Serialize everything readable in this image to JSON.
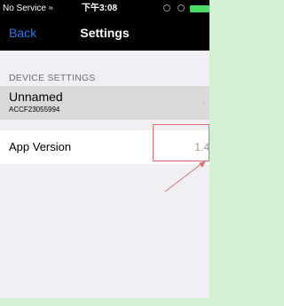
{
  "status_bar": {
    "carrier": "No Service",
    "wifi_icon": "wifi-icon",
    "time": "下午3:08"
  },
  "nav": {
    "back_label": "Back",
    "title": "Settings"
  },
  "section": {
    "header": "DEVICE SETTINGS"
  },
  "device": {
    "name": "Unnamed",
    "serial": "ACCF23055994"
  },
  "app_version": {
    "label": "App Version",
    "value": "1.4"
  },
  "colors": {
    "background": "#d2f0d2",
    "nav_bar": "#000000",
    "accent": "#1e7cf5",
    "battery": "#4cd964",
    "annotation": "#e07070"
  }
}
